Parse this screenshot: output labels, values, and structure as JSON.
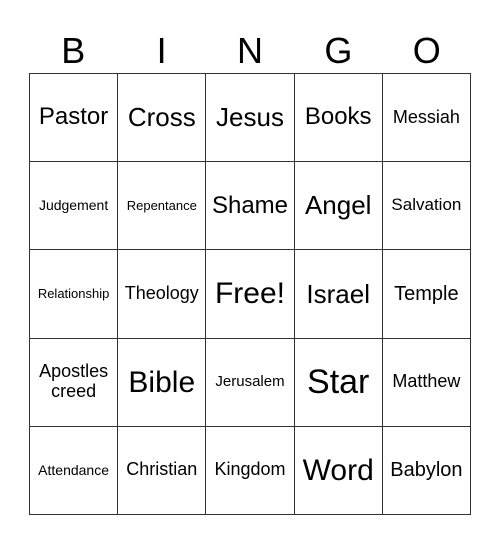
{
  "header": {
    "letters": [
      "B",
      "I",
      "N",
      "G",
      "O"
    ]
  },
  "cells": [
    [
      "Pastor",
      "Cross",
      "Jesus",
      "Books",
      "Messiah"
    ],
    [
      "Judgement",
      "Repentance",
      "Shame",
      "Angel",
      "Salvation"
    ],
    [
      "Relationship",
      "Theology",
      "Free!",
      "Israel",
      "Temple"
    ],
    [
      "Apostles creed",
      "Bible",
      "Jerusalem",
      "Star",
      "Matthew"
    ],
    [
      "Attendance",
      "Christian",
      "Kingdom",
      "Word",
      "Babylon"
    ]
  ]
}
